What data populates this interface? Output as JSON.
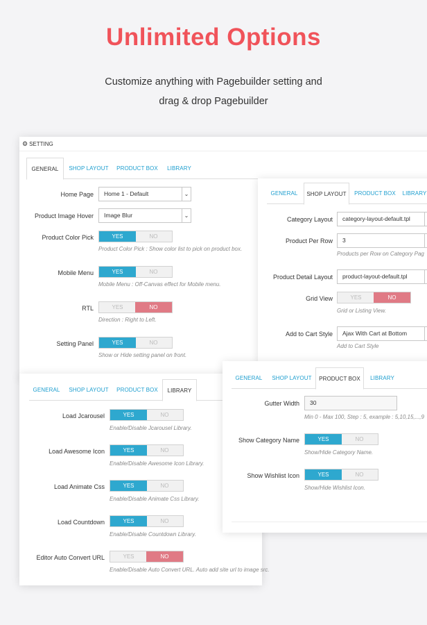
{
  "hero": {
    "title": "Unlimited Options",
    "subtitle_line1": "Customize anything with Pagebuilder setting and",
    "subtitle_line2": "drag & drop Pagebuilder"
  },
  "colors": {
    "accent": "#f0535a",
    "yes": "#2ea8cf",
    "no": "#e07a85",
    "link": "#1d9ecf"
  },
  "setting_panel": {
    "header": "SETTING",
    "header_icon": "gears-icon",
    "tabs": [
      "GENERAL",
      "SHOP LAYOUT",
      "PRODUCT BOX",
      "LIBRARY"
    ],
    "active_tab": "GENERAL",
    "fields": {
      "home_page": {
        "label": "Home Page",
        "value": "Home 1 - Default"
      },
      "hover": {
        "label": "Product Image Hover",
        "value": "Image Blur"
      },
      "color_pick": {
        "label": "Product Color Pick",
        "yes": "YES",
        "no": "NO",
        "selected": "YES",
        "help": "Product Color Pick : Show color list to pick on product box."
      },
      "mobile_menu": {
        "label": "Mobile Menu",
        "yes": "YES",
        "no": "NO",
        "selected": "YES",
        "help": "Mobile Menu : Off-Canvas effect for Mobile menu."
      },
      "rtl": {
        "label": "RTL",
        "yes": "YES",
        "no": "NO",
        "selected": "NO",
        "help": "Direction : Right to Left."
      },
      "setting_panel": {
        "label": "Setting Panel",
        "yes": "YES",
        "no": "NO",
        "selected": "YES",
        "help": "Show or Hide setting panel on front."
      }
    }
  },
  "shop_panel": {
    "tabs": [
      "GENERAL",
      "SHOP LAYOUT",
      "PRODUCT BOX",
      "LIBRARY"
    ],
    "active_tab": "SHOP LAYOUT",
    "fields": {
      "category_layout": {
        "label": "Category Layout",
        "value": "category-layout-default.tpl"
      },
      "per_row": {
        "label": "Product Per Row",
        "value": "3",
        "help": "Products per Row on Category Pag"
      },
      "detail_layout": {
        "label": "Product Detail Layout",
        "value": "product-layout-default.tpl"
      },
      "grid_view": {
        "label": "Grid View",
        "yes": "YES",
        "no": "NO",
        "selected": "NO",
        "help": "Grid or Listing View."
      },
      "add_to_cart": {
        "label": "Add to Cart Style",
        "value": "Ajax With Cart at Bottom",
        "help": "Add to Cart Style"
      }
    }
  },
  "library_panel": {
    "tabs": [
      "GENERAL",
      "SHOP LAYOUT",
      "PRODUCT BOX",
      "LIBRARY"
    ],
    "active_tab": "LIBRARY",
    "fields": {
      "jcarousel": {
        "label": "Load Jcarousel",
        "yes": "YES",
        "no": "NO",
        "selected": "YES",
        "help": "Enable/Disable Jcarousel Library."
      },
      "awesome": {
        "label": "Load Awesome Icon",
        "yes": "YES",
        "no": "NO",
        "selected": "YES",
        "help": "Enable/Disable Awesome Icon Library."
      },
      "animate": {
        "label": "Load Animate Css",
        "yes": "YES",
        "no": "NO",
        "selected": "YES",
        "help": "Enable/Disable Animate Css Library."
      },
      "countdown": {
        "label": "Load Countdown",
        "yes": "YES",
        "no": "NO",
        "selected": "YES",
        "help": "Enable/Disable Countdown Library."
      },
      "auto_url": {
        "label": "Editor Auto Convert URL",
        "yes": "YES",
        "no": "NO",
        "selected": "NO",
        "help": "Enable/Disable Auto Convert URL. Auto add site url to image src."
      }
    }
  },
  "productbox_panel": {
    "tabs": [
      "GENERAL",
      "SHOP LAYOUT",
      "PRODUCT BOX",
      "LIBRARY"
    ],
    "active_tab": "PRODUCT BOX",
    "fields": {
      "gutter": {
        "label": "Gutter Width",
        "value": "30",
        "help": "Min 0 - Max 100, Step : 5, example : 5,10,15,...,9"
      },
      "show_category": {
        "label": "Show Category Name",
        "yes": "YES",
        "no": "NO",
        "selected": "YES",
        "help": "Show/Hide Category Name."
      },
      "show_wishlist": {
        "label": "Show Wishlist Icon",
        "yes": "YES",
        "no": "NO",
        "selected": "YES",
        "help": "Show/Hide Wishlist Icon."
      }
    }
  }
}
